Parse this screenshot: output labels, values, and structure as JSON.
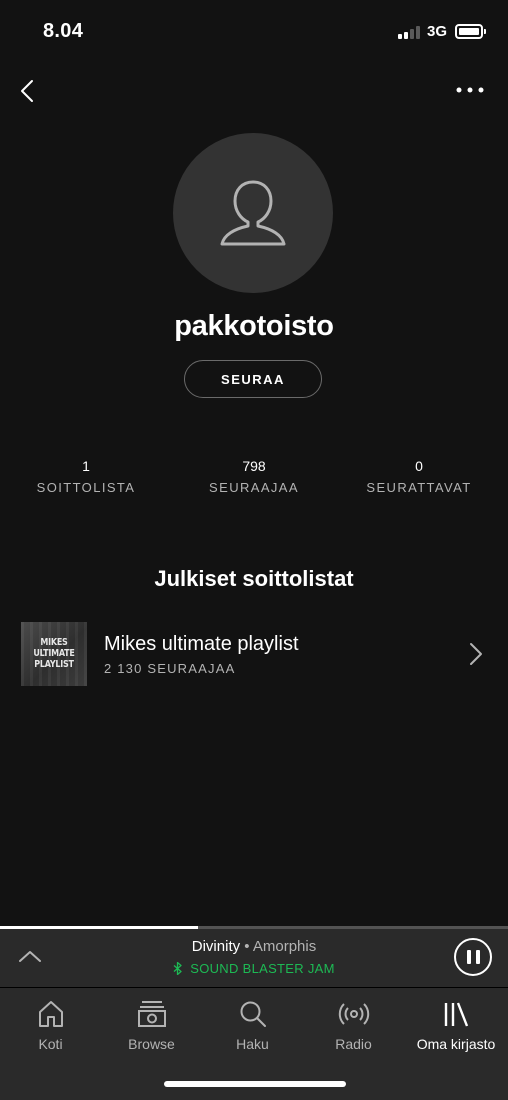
{
  "status_bar": {
    "time": "8.04",
    "network": "3G"
  },
  "profile": {
    "name": "pakkotoisto",
    "follow_label": "SEURAA"
  },
  "stats": [
    {
      "value": "1",
      "label": "SOITTOLISTA"
    },
    {
      "value": "798",
      "label": "SEURAAJAA"
    },
    {
      "value": "0",
      "label": "SEURATTAVAT"
    }
  ],
  "playlists_section": {
    "title": "Julkiset soittolistat",
    "items": [
      {
        "title": "Mikes ultimate playlist",
        "followers": "2 130 SEURAAJAA",
        "cover_text": "MIKES ULTIMATE PLAYLIST"
      }
    ]
  },
  "now_playing": {
    "title": "Divinity",
    "separator": " • ",
    "artist": "Amorphis",
    "device": "SOUND BLASTER JAM",
    "device_color": "#1db954",
    "progress": 0.39
  },
  "tabs": [
    {
      "label": "Koti",
      "icon": "home-icon"
    },
    {
      "label": "Browse",
      "icon": "browse-icon"
    },
    {
      "label": "Haku",
      "icon": "search-icon"
    },
    {
      "label": "Radio",
      "icon": "radio-icon"
    },
    {
      "label": "Oma kirjasto",
      "icon": "library-icon",
      "active": true
    }
  ]
}
